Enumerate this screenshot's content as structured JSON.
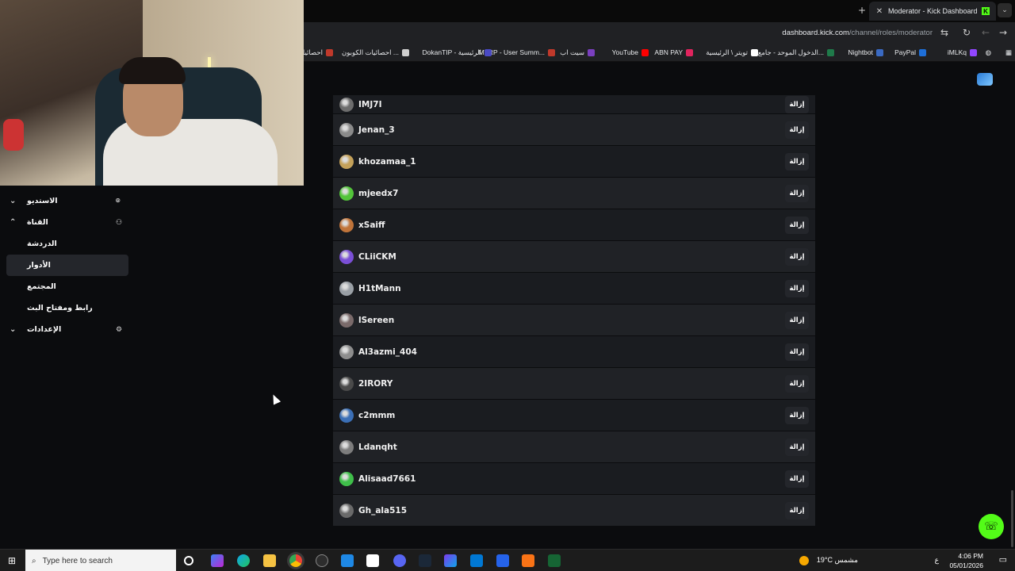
{
  "browser": {
    "tab_title": "Moderator - Kick Dashboard",
    "new_tab": "+",
    "url_domain": "dashboard.kick.com",
    "url_path": "/channel/roles/moderator",
    "bookmarks": [
      {
        "label": "iMLKq",
        "color": "#9146ff"
      },
      {
        "label": "PayPal",
        "color": "#1e6fd9"
      },
      {
        "label": "Nightbot",
        "color": "#3a6ac3"
      },
      {
        "label": "الدخول الموحد - جامع...",
        "color": "#1f7a4a"
      },
      {
        "label": "تويتر \\ الرئيسية",
        "color": "#ffffff"
      },
      {
        "label": "ABN PAY",
        "color": "#e0245e"
      },
      {
        "label": "YouTube",
        "color": "#ff0000"
      },
      {
        "label": "سيت اب",
        "color": "#7a3fbf"
      },
      {
        "label": "MTRP - User Summ...",
        "color": "#c0392b"
      },
      {
        "label": "DokanTIP - الرئيسية",
        "color": "#4a4ac4"
      },
      {
        "label": "احصائيات الكوبون ...",
        "color": "#cfcfcf"
      },
      {
        "label": "احصائيات",
        "color": "#c0392b"
      }
    ]
  },
  "sidebar": {
    "items": [
      {
        "label": "الاستديو",
        "type": "top",
        "chevron": "⌄"
      },
      {
        "label": "القناة",
        "type": "top",
        "chevron": "⌃"
      },
      {
        "label": "الدردشة",
        "type": "sub"
      },
      {
        "label": "الأدوار",
        "type": "sub",
        "active": true
      },
      {
        "label": "المجتمع",
        "type": "sub"
      },
      {
        "label": "رابط ومفتاح البث",
        "type": "sub"
      },
      {
        "label": "الإعدادات",
        "type": "top",
        "chevron": "⌄"
      }
    ]
  },
  "moderators": {
    "remove_label": "إزالة",
    "rows": [
      {
        "name": "IMJ7I",
        "color": "#6d6d6d"
      },
      {
        "name": "Jenan_3",
        "color": "#8a8a8a"
      },
      {
        "name": "khozamaa_1",
        "color": "#c4a15a"
      },
      {
        "name": "mjeedx7",
        "color": "#53c43a"
      },
      {
        "name": "xSaiff",
        "color": "#c0743a"
      },
      {
        "name": "CLiiCKM",
        "color": "#7a4fd6"
      },
      {
        "name": "H1tMann",
        "color": "#9aa0a6"
      },
      {
        "name": "lSereen",
        "color": "#7a6a6a"
      },
      {
        "name": "Al3azmi_404",
        "color": "#8d8d8d"
      },
      {
        "name": "2IRORY",
        "color": "#4a4a4a"
      },
      {
        "name": "c2mmm",
        "color": "#3b6fb6"
      },
      {
        "name": "Ldanqht",
        "color": "#7d7d7d"
      },
      {
        "name": "Alisaad7661",
        "color": "#3fbf4a"
      },
      {
        "name": "Gh_ala515",
        "color": "#6a6a6a"
      }
    ]
  },
  "taskbar": {
    "search_placeholder": "Type here to search",
    "weather": "19°C مشمس",
    "lang": "ع",
    "time": "4:06 PM",
    "date": "05/01/2026"
  },
  "accent": "#53fc18"
}
